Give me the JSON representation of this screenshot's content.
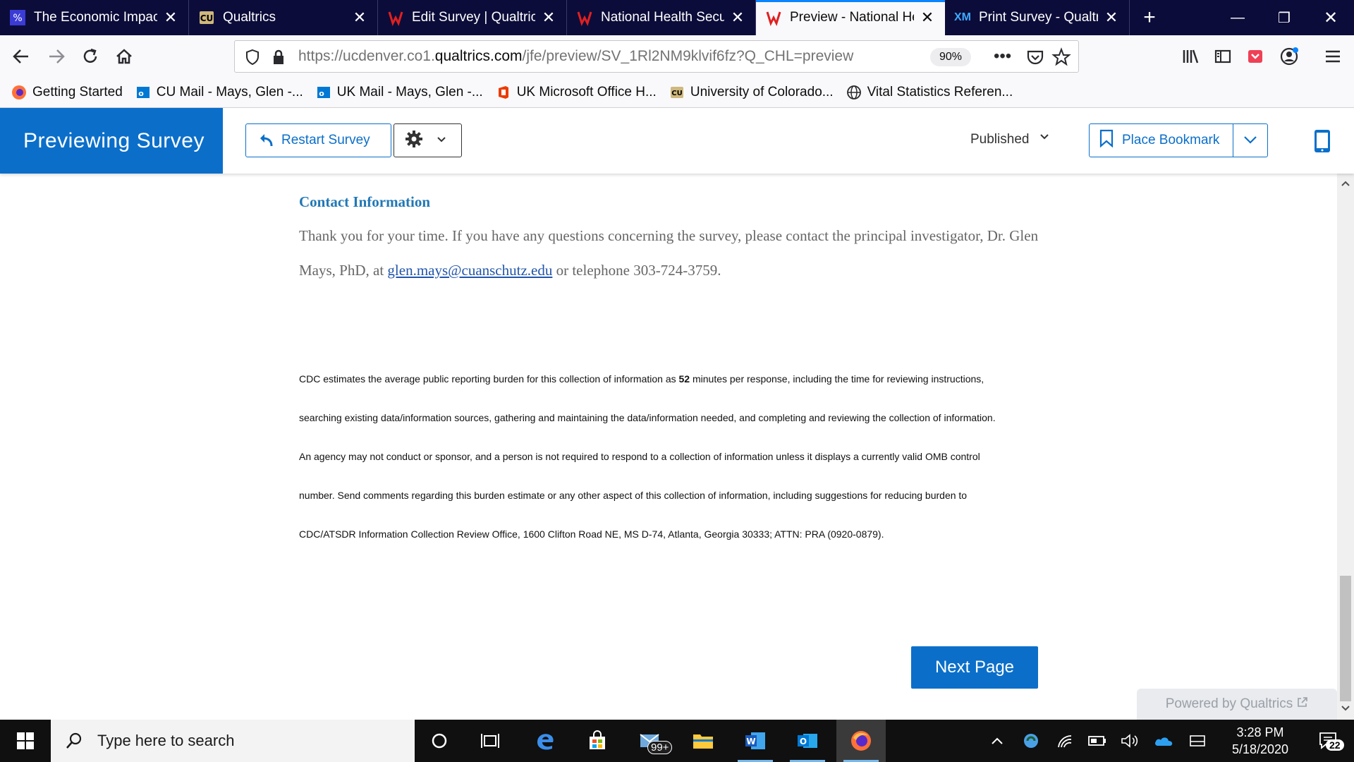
{
  "tabs": [
    {
      "title": "The Economic Impact",
      "icon": "uc-logo-icon"
    },
    {
      "title": "Qualtrics",
      "icon": "cu-logo-icon"
    },
    {
      "title": "Edit Survey | Qualtrics",
      "icon": "qualtrics-icon"
    },
    {
      "title": "National Health Securi",
      "icon": "qualtrics-icon"
    },
    {
      "title": "Preview - National He",
      "icon": "qualtrics-icon"
    },
    {
      "title": "Print Survey - Qualtric",
      "icon": "xm-icon"
    }
  ],
  "browser": {
    "url_prefix": "https://ucdenver.co1.",
    "url_domain": "qualtrics.com",
    "url_suffix": "/jfe/preview/SV_1Rl2NM9klvif6fz?Q_CHL=preview",
    "zoom": "90%",
    "xm_label": "XM"
  },
  "bookmarks": [
    {
      "label": "Getting Started"
    },
    {
      "label": "CU Mail - Mays, Glen -..."
    },
    {
      "label": "UK Mail - Mays, Glen -..."
    },
    {
      "label": "UK Microsoft Office H..."
    },
    {
      "label": "University of Colorado..."
    },
    {
      "label": "Vital Statistics Referen..."
    }
  ],
  "header": {
    "title": "Previewing Survey",
    "restart_label": "Restart Survey",
    "status": "Published",
    "bookmark_label": "Place Bookmark"
  },
  "content": {
    "section_title": "Contact Information",
    "contact_part1": "Thank you for your time. If you have any questions concerning the survey, please contact the principal investigator, Dr. Glen Mays, PhD, at ",
    "contact_email": "glen.mays@cuanschutz.edu",
    "contact_part2": " or telephone 303-724-3759.",
    "burden_line1a": "CDC estimates the average public reporting burden for this collection of information as ",
    "burden_minutes": "52",
    "burden_line1b": " minutes per response, including the time for reviewing instructions,",
    "burden_line2": "searching existing data/information sources, gathering and maintaining the data/information needed, and completing and reviewing the collection of information.",
    "burden_line3": "An agency may not conduct or sponsor, and a person is not required to respond to a collection of information unless it displays a currently valid OMB control",
    "burden_line4": "number. Send comments regarding this burden estimate or any other aspect of this collection of information, including suggestions for reducing burden to",
    "burden_line5": "CDC/ATSDR Information Collection Review Office, 1600 Clifton Road NE, MS D-74, Atlanta, Georgia 30333; ATTN: PRA (0920-0879).",
    "next_label": "Next Page",
    "powered_label": "Powered by Qualtrics"
  },
  "taskbar": {
    "search_placeholder": "Type here to search",
    "mail_badge": "99+",
    "time": "3:28 PM",
    "date": "5/18/2020",
    "notification_count": "22"
  },
  "colors": {
    "qualtrics_blue": "#0b6fca",
    "tab_bg": "#0c0c3a",
    "link_title": "#2278b5"
  }
}
